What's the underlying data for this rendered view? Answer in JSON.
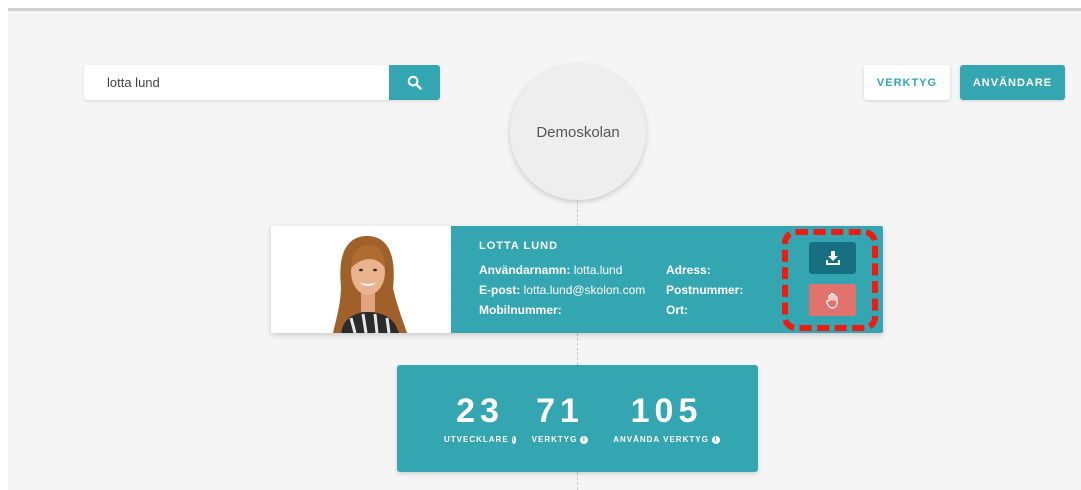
{
  "search": {
    "value": "lotta lund",
    "button_icon": "search-icon"
  },
  "top_buttons": {
    "tools": "VERKTYG",
    "users": "ANVÄNDARE"
  },
  "school": {
    "name": "Demoskolan"
  },
  "user": {
    "name": "LOTTA LUND",
    "username_label": "Användarnamn:",
    "username": "lotta.lund",
    "email_label": "E-post:",
    "email": "lotta.lund@skolon.com",
    "mobile_label": "Mobilnummer:",
    "mobile": "",
    "address_label": "Adress:",
    "address": "",
    "postal_label": "Postnummer:",
    "postal": "",
    "city_label": "Ort:",
    "city": ""
  },
  "actions": {
    "download_icon": "download-icon",
    "block_icon": "hand-icon"
  },
  "highlight_color": "#ef1b10",
  "accent_color": "#34a6b1",
  "stats": [
    {
      "value": "23",
      "label": "UTVECKLARE"
    },
    {
      "value": "71",
      "label": "VERKTYG"
    },
    {
      "value": "105",
      "label": "ANVÄNDA VERKTYG"
    }
  ]
}
